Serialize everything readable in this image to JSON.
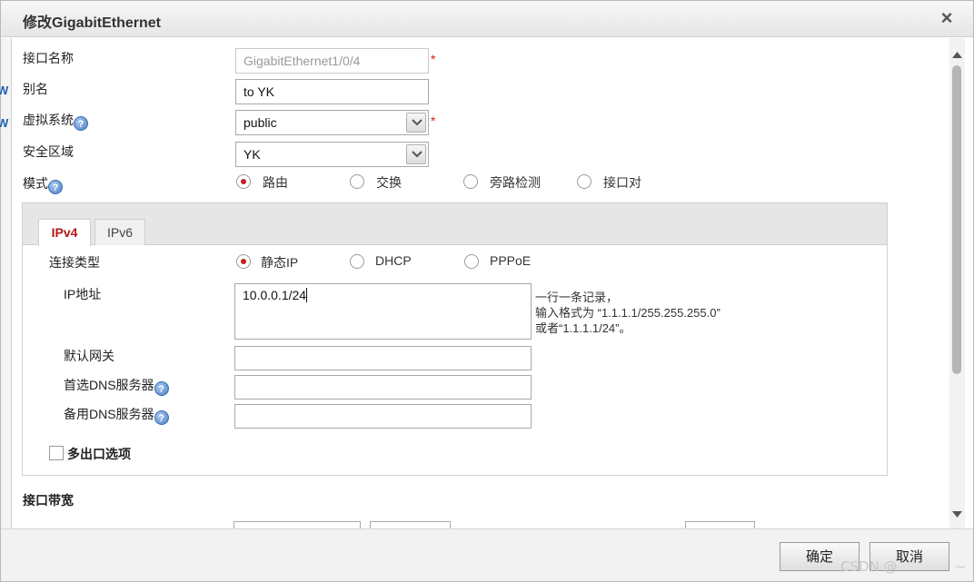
{
  "dialog": {
    "title": "修改GigabitEthernet",
    "close_glyph": "×"
  },
  "background": {
    "frag1": "W",
    "frag2": "W"
  },
  "form": {
    "interface_name": {
      "label": "接口名称",
      "value": "GigabitEthernet1/0/4",
      "required": "*"
    },
    "alias": {
      "label": "别名",
      "value": "to YK"
    },
    "vsys": {
      "label": "虚拟系统",
      "value": "public",
      "required": "*"
    },
    "zone": {
      "label": "安全区域",
      "value": "YK"
    },
    "mode": {
      "label": "模式",
      "options": [
        "路由",
        "交换",
        "旁路检测",
        "接口对"
      ],
      "selected": "路由"
    }
  },
  "help_glyph": "?",
  "tabs": [
    "IPv4",
    "IPv6"
  ],
  "ipv4": {
    "conn_type": {
      "label": "连接类型",
      "options": [
        "静态IP",
        "DHCP",
        "PPPoE"
      ],
      "selected": "静态IP"
    },
    "ip": {
      "label": "IP地址",
      "value": "10.0.0.1/24",
      "hint_line1": "一行一条记录，",
      "hint_line2": "输入格式为 “1.1.1.1/255.255.255.0”",
      "hint_line3": "或者“1.1.1.1/24”。"
    },
    "gateway": {
      "label": "默认网关",
      "value": ""
    },
    "dns1": {
      "label": "首选DNS服务器",
      "value": ""
    },
    "dns2": {
      "label": "备用DNS服务器",
      "value": ""
    },
    "multi_egress": {
      "label": "多出口选项",
      "checked": false
    }
  },
  "bandwidth": {
    "heading": "接口带宽"
  },
  "footer": {
    "ok": "确定",
    "cancel": "取消"
  },
  "watermark": "CSDN @",
  "watermark_tail": "~"
}
